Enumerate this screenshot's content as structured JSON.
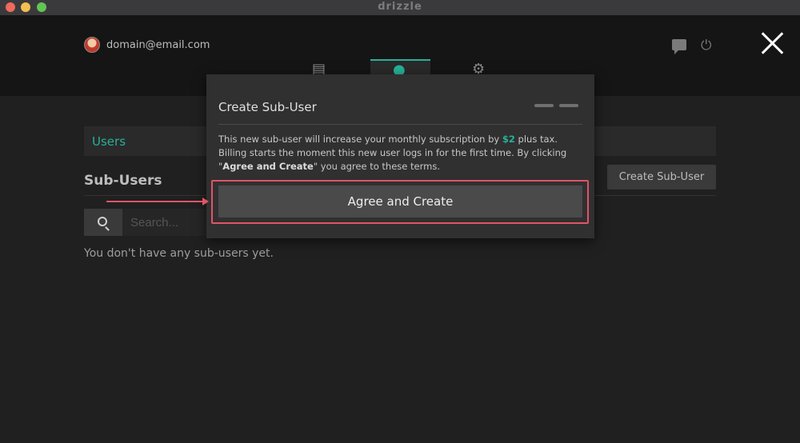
{
  "app": {
    "title": "drizzle"
  },
  "header": {
    "user_email": "domain@email.com",
    "icons": [
      "avatar",
      "chat-icon",
      "logout-icon",
      "close-icon"
    ],
    "tabs": [
      {
        "icon": "billing-icon",
        "active": false
      },
      {
        "icon": "user-icon",
        "active": true
      },
      {
        "icon": "gear-icon",
        "active": false
      }
    ]
  },
  "page": {
    "users_label": "Users",
    "subusers_heading": "Sub-Users",
    "create_button": "Create Sub-User",
    "search_placeholder": "Search...",
    "empty_text": "You don't have any sub-users yet."
  },
  "modal": {
    "title": "Create Sub-User",
    "body_1": "This new sub-user will increase your monthly subscription by ",
    "price": "$2",
    "body_2": " plus tax. Billing starts the moment this new user logs in for the first time. By clicking \"",
    "emph": "Agree and Create",
    "body_3": "\" you agree to these terms.",
    "agree_button": "Agree and Create"
  },
  "colors": {
    "accent": "#27b19a",
    "highlight": "#e05565",
    "background": "#202020"
  }
}
